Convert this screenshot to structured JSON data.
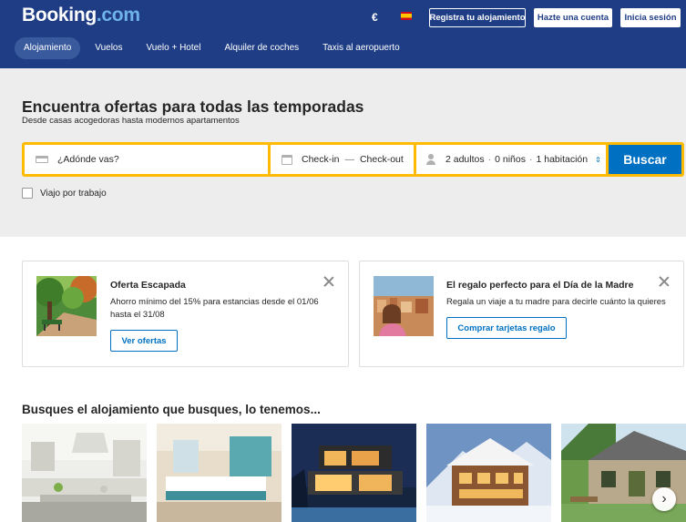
{
  "header": {
    "logo_main": "Booking",
    "logo_domain": ".com",
    "currency": "€",
    "flag_icon": "spain-flag-icon",
    "register_property": "Registra tu alojamiento",
    "create_account": "Hazte una cuenta",
    "sign_in": "Inicia sesión",
    "brand_color": "#1f3d85"
  },
  "nav": {
    "items": [
      {
        "label": "Alojamiento",
        "active": true
      },
      {
        "label": "Vuelos"
      },
      {
        "label": "Vuelo + Hotel"
      },
      {
        "label": "Alquiler de coches"
      },
      {
        "label": "Taxis al aeropuerto"
      }
    ]
  },
  "hero": {
    "title": "Encuentra ofertas para todas las temporadas",
    "subtitle": "Desde casas acogedoras hasta modernos apartamentos"
  },
  "search": {
    "destination_placeholder": "¿Adónde vas?",
    "checkin": "Check-in",
    "dash": "—",
    "checkout": "Check-out",
    "adults": "2 adultos",
    "children": "0 niños",
    "rooms": "1 habitación",
    "separator": "·",
    "button": "Buscar",
    "accent_color": "#febb02",
    "button_color": "#0071c2"
  },
  "work_trip": {
    "label": "Viajo por trabajo",
    "checked": false
  },
  "promos": [
    {
      "title": "Oferta Escapada",
      "text": "Ahorro mínimo del 15% para estancias desde el 01/06 hasta el 31/08",
      "button": "Ver ofertas"
    },
    {
      "title": "El regalo perfecto para el Día de la Madre",
      "text": "Regala un viaje a tu madre para decirle cuánto la quieres",
      "button": "Comprar tarjetas regalo"
    }
  ],
  "property_types": {
    "title": "Busques el alojamiento que busques, lo tenemos...",
    "next_icon": "chevron-right-icon"
  }
}
